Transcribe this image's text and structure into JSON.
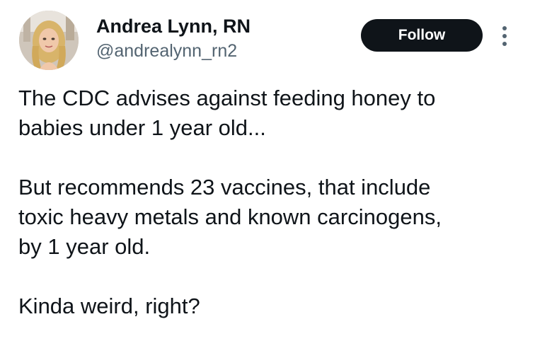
{
  "author": {
    "display_name": "Andrea Lynn, RN",
    "handle": "@andrealynn_rn2",
    "avatar_icon": "profile-photo"
  },
  "actions": {
    "follow_label": "Follow",
    "more_icon": "more-vertical-icon"
  },
  "tweet": {
    "paragraphs": [
      "The CDC advises against feeding honey to\nbabies under 1 year old...",
      "But recommends 23 vaccines, that include\ntoxic heavy metals and known carcinogens,\nby 1 year old.",
      "Kinda weird, right?"
    ]
  },
  "colors": {
    "text_primary": "#0f1419",
    "text_secondary": "#536471",
    "follow_bg": "#0f1419",
    "follow_text": "#ffffff",
    "background": "#ffffff"
  }
}
